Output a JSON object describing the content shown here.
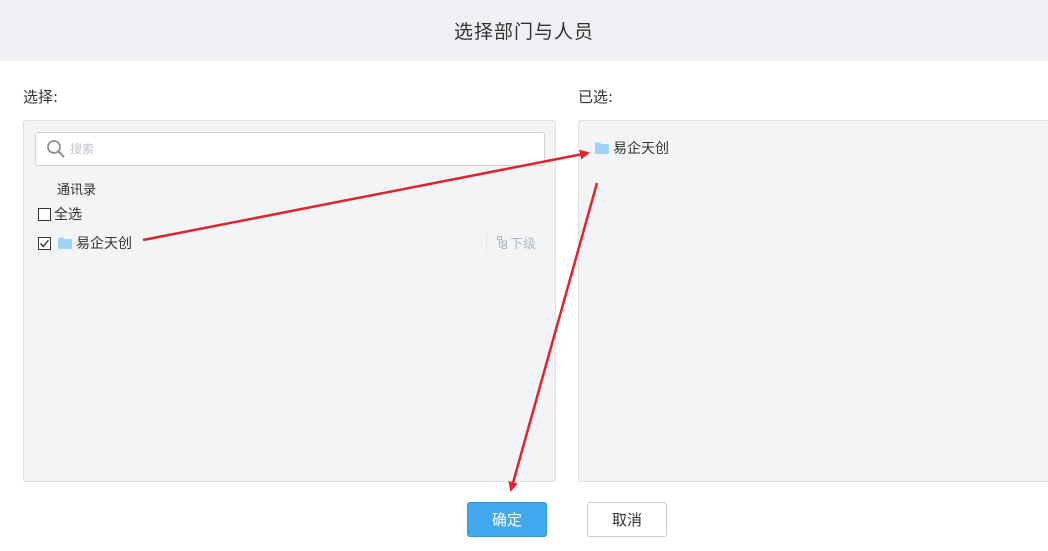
{
  "dialog": {
    "title": "选择部门与人员"
  },
  "picker": {
    "label": "选择:",
    "search": {
      "placeholder": "搜索",
      "value": ""
    },
    "tree_root": "通讯录",
    "select_all_label": "全选",
    "items": [
      {
        "label": "易企天创",
        "checked": true,
        "sub_label": "下级"
      }
    ]
  },
  "selected": {
    "label": "已选:",
    "items": [
      {
        "label": "易企天创"
      }
    ]
  },
  "buttons": {
    "confirm": "确定",
    "cancel": "取消"
  },
  "colors": {
    "primary": "#41a8ef",
    "header_bg": "#eef0f3",
    "panel_bg": "#f3f4f6",
    "annotation": "#e0242e",
    "folder": "#9fd3f5"
  },
  "icons": [
    "search-icon",
    "checkbox-icon",
    "folder-icon",
    "org-tree-icon"
  ]
}
